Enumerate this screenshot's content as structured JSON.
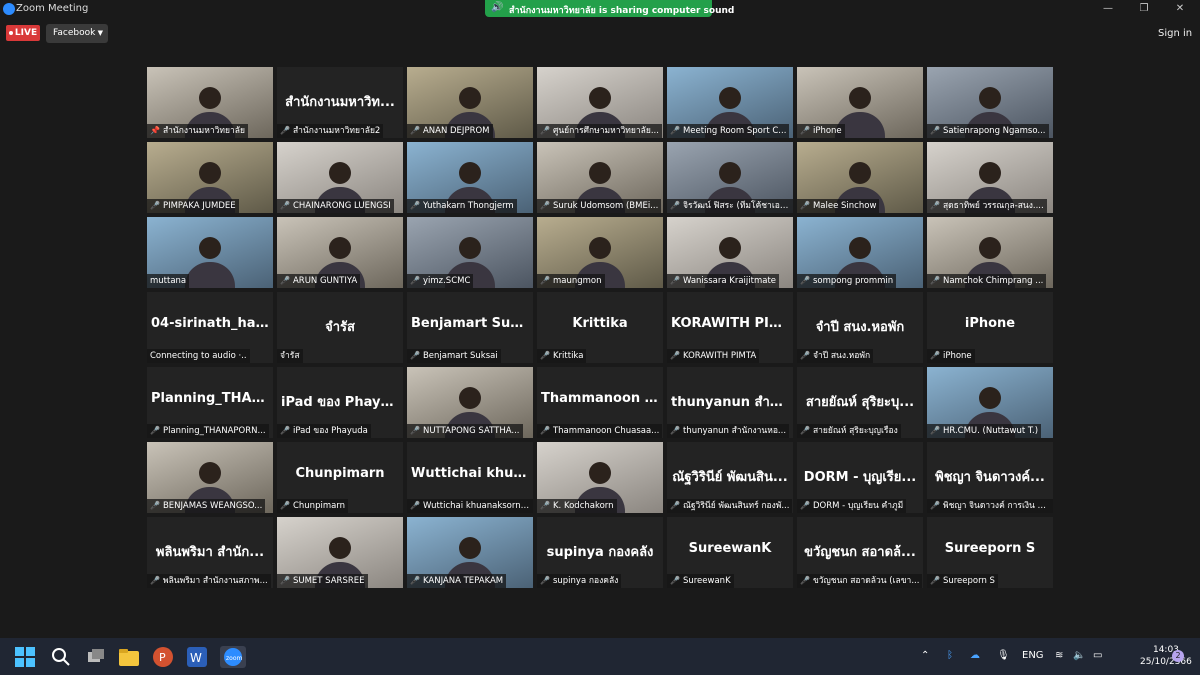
{
  "window": {
    "title": "Zoom Meeting"
  },
  "share_banner": {
    "text": "สำนักงานมหาวิทยาลัย is sharing computer sound"
  },
  "toolbar": {
    "live_label": "LIVE",
    "platform_label": "Facebook",
    "signin_label": "Sign in"
  },
  "participants": [
    {
      "name": "สำนักงานมหาวิทยาลัย",
      "video": true,
      "active": true,
      "pinned": true
    },
    {
      "name": "สำนักงานมหาวิทยาลัย2",
      "big": "สำนักงานมหาวิท...",
      "video": false,
      "muted": true
    },
    {
      "name": "ANAN DEJPROM",
      "video": true,
      "muted": true
    },
    {
      "name": "ศูนย์การศึกษามหาวิทยาลัย...",
      "video": true,
      "muted": true
    },
    {
      "name": "Meeting Room Sport C...",
      "video": true,
      "muted": true
    },
    {
      "name": "iPhone",
      "video": true,
      "muted": true
    },
    {
      "name": "Satienrapong Ngamso...",
      "video": true,
      "muted": true
    },
    {
      "name": "PIMPAKA JUMDEE",
      "video": true,
      "muted": true
    },
    {
      "name": "CHAINARONG LUENGSI",
      "video": true,
      "muted": true
    },
    {
      "name": "Yuthakarn Thongjerm",
      "video": true,
      "muted": true
    },
    {
      "name": "Suruk Udomsom (BMEi...",
      "video": true,
      "muted": true
    },
    {
      "name": "จิรวัฒน์ ฟิสระ (ทีมโค้ชาเอม...",
      "video": true,
      "muted": true
    },
    {
      "name": "Malee Sinchow",
      "video": true,
      "muted": true
    },
    {
      "name": "สุดธาทิพย์ วรรณกุล-สนง....",
      "video": true,
      "muted": true
    },
    {
      "name": "muttana",
      "video": true,
      "muted": false
    },
    {
      "name": "ARUN GUNTIYA",
      "video": true,
      "muted": true
    },
    {
      "name": "yimz.SCMC",
      "video": true,
      "muted": true
    },
    {
      "name": "maungmon",
      "video": true,
      "muted": true
    },
    {
      "name": "Wanissara Kraijitmate",
      "video": true,
      "muted": true
    },
    {
      "name": "sompong prommin",
      "video": true,
      "muted": true
    },
    {
      "name": "Namchok Chimprang ...",
      "video": true,
      "muted": true
    },
    {
      "name": "Connecting to audio ·..",
      "big": "04-sirinath_hanc...",
      "video": false,
      "muted": false
    },
    {
      "name": "จำรัส",
      "big": "จำรัส",
      "video": false,
      "muted": false
    },
    {
      "name": "Benjamart Suksai",
      "big": "Benjamart Suksai",
      "video": false,
      "muted": true
    },
    {
      "name": "Krittika",
      "big": "Krittika",
      "video": false,
      "muted": true
    },
    {
      "name": "KORAWITH PIMTA",
      "big": "KORAWITH PIM...",
      "video": false,
      "muted": true
    },
    {
      "name": "จำปี สนง.หอพัก",
      "big": "จำปี สนง.หอพัก",
      "video": false,
      "muted": true
    },
    {
      "name": "iPhone",
      "big": "iPhone",
      "video": false,
      "muted": true
    },
    {
      "name": "Planning_THANAPORN...",
      "big": "Planning_THAN...",
      "video": false,
      "muted": true
    },
    {
      "name": "iPad ของ Phayuda",
      "big": "iPad ของ Phayuda",
      "video": false,
      "muted": true
    },
    {
      "name": "NUTTAPONG SATTHA...",
      "video": true,
      "muted": true
    },
    {
      "name": "Thammanoon Chuasaa...",
      "big": "Thammanoon C...",
      "video": false,
      "muted": true
    },
    {
      "name": "thunyanun สำนักงานหอ...",
      "big": "thunyanun สำนั...",
      "video": false,
      "muted": true
    },
    {
      "name": "สายยัณห์ สุริยะบุญเรือง",
      "big": "สายยัณห์ สุริยะบุ...",
      "video": false,
      "muted": true
    },
    {
      "name": "HR.CMU. (Nuttawut T.)",
      "video": true,
      "muted": true
    },
    {
      "name": "BENJAMAS WEANGSO...",
      "video": true,
      "muted": true
    },
    {
      "name": "Chunpimarn",
      "big": "Chunpimarn",
      "video": false,
      "muted": true
    },
    {
      "name": "Wuttichai khuanaksorn C...",
      "big": "Wuttichai khua...",
      "video": false,
      "muted": true
    },
    {
      "name": "K. Kodchakorn",
      "video": true,
      "muted": true
    },
    {
      "name": "ณัฐวิรินีย์ พัฒนสินทร์ กองพั...",
      "big": "ณัฐวิรินีย์ พัฒนสิน...",
      "video": false,
      "muted": true
    },
    {
      "name": "DORM - บุญเรียน คำภูมี",
      "big": "DORM - บุญเรีย...",
      "video": false,
      "muted": true
    },
    {
      "name": "พิชญา จินดาวงค์ การเงิน ก...",
      "big": "พิชญา จินดาวงค์...",
      "video": false,
      "muted": true
    },
    {
      "name": "พลินพริมา สำนักงานสภาพ...",
      "big": "พลินพริมา สำนัก...",
      "video": false,
      "muted": true
    },
    {
      "name": "SUMET SARSREE",
      "video": true,
      "muted": true
    },
    {
      "name": "KANJANA TEPAKAM",
      "video": true,
      "muted": true
    },
    {
      "name": "supinya กองคลัง",
      "big": "supinya กองคลัง",
      "video": false,
      "muted": true
    },
    {
      "name": "SureewanK",
      "big": "SureewanK",
      "video": false,
      "muted": true
    },
    {
      "name": "ขวัญชนก สอาดล้วน (เลขา...",
      "big": "ขวัญชนก สอาดล้...",
      "video": false,
      "muted": true
    },
    {
      "name": "Sureeporn S",
      "big": "Sureeporn S",
      "video": false,
      "muted": true
    }
  ],
  "taskbar": {
    "lang": "ENG",
    "time": "14:03",
    "date": "25/10/2566",
    "notifications": "2"
  },
  "colors": {
    "active_border": "#c3d83a",
    "live": "#d93939",
    "banner": "#23a04a",
    "muted_mic": "#e04343"
  }
}
